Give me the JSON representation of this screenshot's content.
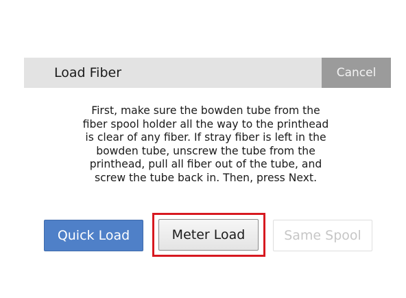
{
  "dialog": {
    "title": "Load Fiber",
    "cancel_label": "Cancel",
    "instructions": "First, make sure the bowden tube from the\nfiber spool holder all the way to the printhead\nis clear of any fiber. If stray fiber is left in the\nbowden tube, unscrew the tube from the\nprinthead, pull all fiber out of the tube, and\nscrew the tube back in. Then, press Next."
  },
  "buttons": {
    "quick_load": "Quick Load",
    "meter_load": "Meter Load",
    "same_spool": "Same Spool",
    "same_spool_enabled": false
  },
  "colors": {
    "header_bg": "#e3e3e3",
    "cancel_bg": "#9b9b9b",
    "primary_button": "#4f80c8",
    "highlight_border": "#d71920",
    "disabled_text": "#c6c6c6"
  }
}
